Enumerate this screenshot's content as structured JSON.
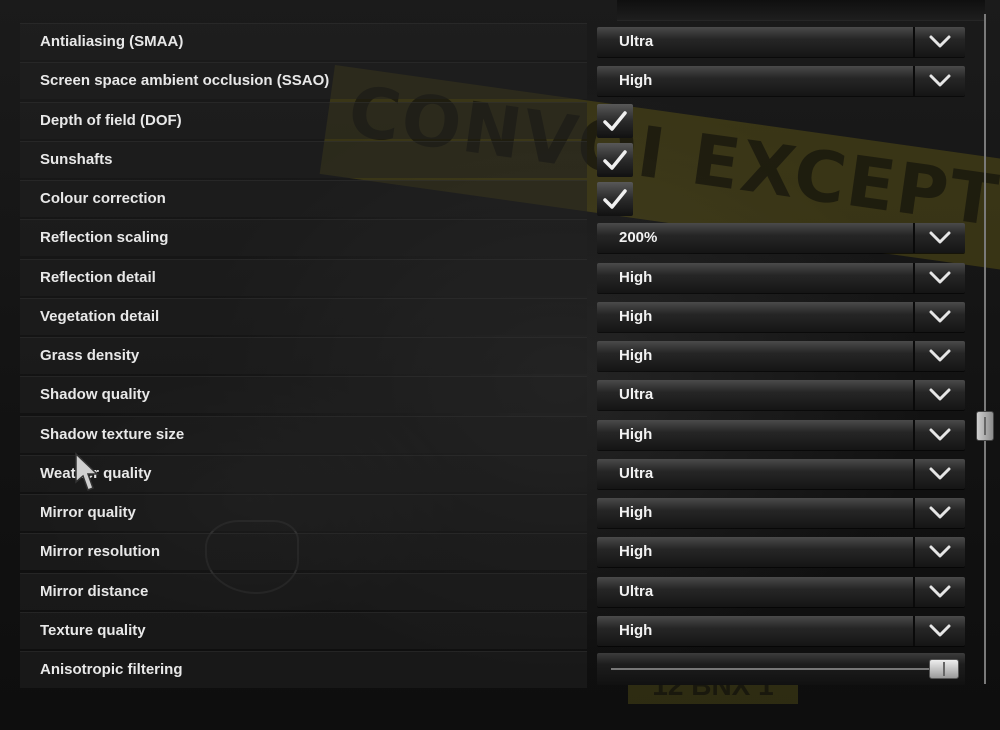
{
  "background": {
    "banner_text": "CONVOI EXCEPTIONNEL",
    "plate_text": "12 BNX 1"
  },
  "settings": [
    {
      "label": "Antialiasing (SMAA)",
      "type": "dropdown",
      "value": "Ultra"
    },
    {
      "label": "Screen space ambient occlusion (SSAO)",
      "type": "dropdown",
      "value": "High"
    },
    {
      "label": "Depth of field (DOF)",
      "type": "checkbox",
      "checked": true
    },
    {
      "label": "Sunshafts",
      "type": "checkbox",
      "checked": true
    },
    {
      "label": "Colour correction",
      "type": "checkbox",
      "checked": true
    },
    {
      "label": "Reflection scaling",
      "type": "dropdown",
      "value": "200%"
    },
    {
      "label": "Reflection detail",
      "type": "dropdown",
      "value": "High"
    },
    {
      "label": "Vegetation detail",
      "type": "dropdown",
      "value": "High"
    },
    {
      "label": "Grass density",
      "type": "dropdown",
      "value": "High"
    },
    {
      "label": "Shadow quality",
      "type": "dropdown",
      "value": "Ultra"
    },
    {
      "label": "Shadow texture size",
      "type": "dropdown",
      "value": "High"
    },
    {
      "label": "Weather quality",
      "type": "dropdown",
      "value": "Ultra"
    },
    {
      "label": "Mirror quality",
      "type": "dropdown",
      "value": "High"
    },
    {
      "label": "Mirror resolution",
      "type": "dropdown",
      "value": "High"
    },
    {
      "label": "Mirror distance",
      "type": "dropdown",
      "value": "Ultra"
    },
    {
      "label": "Texture quality",
      "type": "dropdown",
      "value": "High"
    },
    {
      "label": "Anisotropic filtering",
      "type": "slider",
      "level": 1.0
    }
  ],
  "scrollbar": {
    "position": 0.62
  },
  "icons": {
    "dropdown_arrow": "chevron-down-icon",
    "checkbox": "checkmark-icon",
    "cursor": "mouse-pointer-icon"
  }
}
